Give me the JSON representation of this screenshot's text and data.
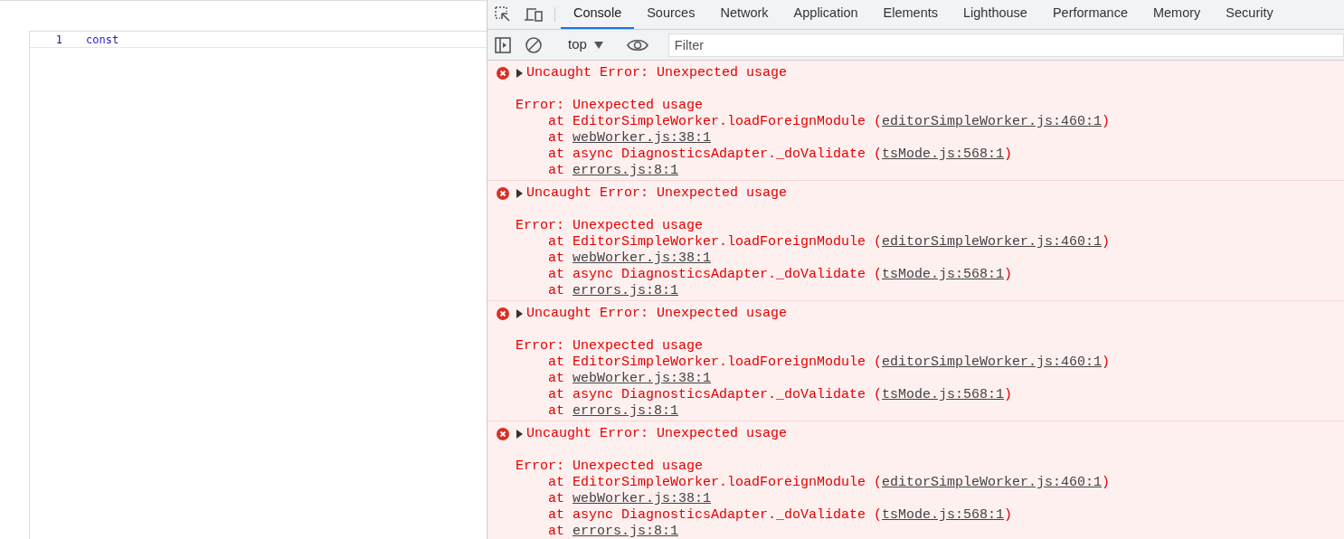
{
  "editor": {
    "lines": [
      {
        "number": "1",
        "code": "const"
      }
    ]
  },
  "devtools": {
    "tabs": [
      {
        "label": "Console",
        "selected": true
      },
      {
        "label": "Sources",
        "selected": false
      },
      {
        "label": "Network",
        "selected": false
      },
      {
        "label": "Application",
        "selected": false
      },
      {
        "label": "Elements",
        "selected": false
      },
      {
        "label": "Lighthouse",
        "selected": false
      },
      {
        "label": "Performance",
        "selected": false
      },
      {
        "label": "Memory",
        "selected": false
      },
      {
        "label": "Security",
        "selected": false
      }
    ],
    "context": "top",
    "filter": {
      "placeholder": "Filter"
    },
    "messages": [
      {
        "title": "Uncaught Error: Unexpected usage",
        "expanded": false,
        "error": "Error: Unexpected usage",
        "stack": [
          {
            "prefix": "at EditorSimpleWorker.loadForeignModule (",
            "link": "editorSimpleWorker.js:460:1",
            "suffix": ")"
          },
          {
            "prefix": "at ",
            "link": "webWorker.js:38:1"
          },
          {
            "prefix": "at async DiagnosticsAdapter._doValidate (",
            "link": "tsMode.js:568:1",
            "suffix": ")"
          },
          {
            "prefix": "at ",
            "link": "errors.js:8:1"
          }
        ]
      },
      {
        "title": "Uncaught Error: Unexpected usage",
        "expanded": false,
        "error": "Error: Unexpected usage",
        "stack": [
          {
            "prefix": "at EditorSimpleWorker.loadForeignModule (",
            "link": "editorSimpleWorker.js:460:1",
            "suffix": ")"
          },
          {
            "prefix": "at ",
            "link": "webWorker.js:38:1"
          },
          {
            "prefix": "at async DiagnosticsAdapter._doValidate (",
            "link": "tsMode.js:568:1",
            "suffix": ")"
          },
          {
            "prefix": "at ",
            "link": "errors.js:8:1"
          }
        ]
      },
      {
        "title": "Uncaught Error: Unexpected usage",
        "expanded": false,
        "error": "Error: Unexpected usage",
        "stack": [
          {
            "prefix": "at EditorSimpleWorker.loadForeignModule (",
            "link": "editorSimpleWorker.js:460:1",
            "suffix": ")"
          },
          {
            "prefix": "at ",
            "link": "webWorker.js:38:1"
          },
          {
            "prefix": "at async DiagnosticsAdapter._doValidate (",
            "link": "tsMode.js:568:1",
            "suffix": ")"
          },
          {
            "prefix": "at ",
            "link": "errors.js:8:1"
          }
        ]
      },
      {
        "title": "Uncaught Error: Unexpected usage",
        "expanded": false,
        "error": "Error: Unexpected usage",
        "stack": [
          {
            "prefix": "at EditorSimpleWorker.loadForeignModule (",
            "link": "editorSimpleWorker.js:460:1",
            "suffix": ")"
          },
          {
            "prefix": "at ",
            "link": "webWorker.js:38:1"
          },
          {
            "prefix": "at async DiagnosticsAdapter._doValidate (",
            "link": "tsMode.js:568:1",
            "suffix": ")"
          },
          {
            "prefix": "at ",
            "link": "errors.js:8:1"
          }
        ]
      }
    ]
  }
}
